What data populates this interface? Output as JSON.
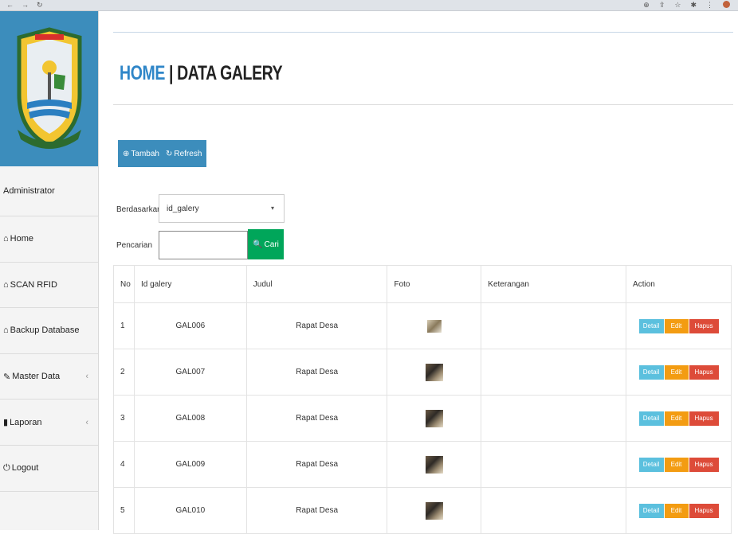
{
  "header": {
    "title_home": "HOME",
    "title_sep": " | ",
    "title_rest": "DATA GALERY"
  },
  "sidebar": {
    "items": [
      {
        "label": "Administrator",
        "icon": ""
      },
      {
        "label": "Home",
        "icon": "home-icon"
      },
      {
        "label": "SCAN RFID",
        "icon": "home-icon"
      },
      {
        "label": "Backup Database",
        "icon": "home-icon"
      },
      {
        "label": "Master Data",
        "icon": "edit-icon",
        "chevron": "‹"
      },
      {
        "label": "Laporan",
        "icon": "book-icon",
        "chevron": "‹"
      },
      {
        "label": "Logout",
        "icon": "power-icon"
      }
    ]
  },
  "toolbar": {
    "tambah_label": "Tambah",
    "refresh_label": "Refresh"
  },
  "filter": {
    "berdasarkan_label": "Berdasarkan:",
    "berdasarkan_value": "id_galery",
    "pencarian_label": "Pencarian",
    "search_value": "",
    "cari_label": "Cari"
  },
  "table": {
    "headers": [
      "No",
      "Id galery",
      "Judul",
      "Foto",
      "Keterangan",
      "Action"
    ],
    "rows": [
      {
        "no": "1",
        "id": "GAL006",
        "judul": "Rapat Desa",
        "keterangan": ""
      },
      {
        "no": "2",
        "id": "GAL007",
        "judul": "Rapat Desa",
        "keterangan": ""
      },
      {
        "no": "3",
        "id": "GAL008",
        "judul": "Rapat Desa",
        "keterangan": ""
      },
      {
        "no": "4",
        "id": "GAL009",
        "judul": "Rapat Desa",
        "keterangan": ""
      },
      {
        "no": "5",
        "id": "GAL010",
        "judul": "Rapat Desa",
        "keterangan": ""
      }
    ],
    "action_labels": {
      "detail": "Detail",
      "edit": "Edit",
      "hapus": "Hapus"
    }
  },
  "colors": {
    "primary": "#3c8dbc",
    "title_blue": "#2f86c8",
    "success": "#00a65a",
    "info": "#5bc0de",
    "warning": "#f39c12",
    "danger": "#dd4b39"
  }
}
